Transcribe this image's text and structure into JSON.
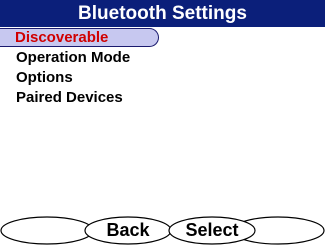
{
  "title": "Bluetooth Settings",
  "menu": {
    "items": [
      {
        "label": "Discoverable",
        "selected": true
      },
      {
        "label": "Operation Mode",
        "selected": false
      },
      {
        "label": "Options",
        "selected": false
      },
      {
        "label": "Paired Devices",
        "selected": false
      }
    ]
  },
  "softkeys": {
    "left": "",
    "back": "Back",
    "select": "Select",
    "right": ""
  },
  "colors": {
    "title_background": "#0b1f7a",
    "selection_background": "#c7c8f0",
    "selection_text": "#d00000"
  }
}
